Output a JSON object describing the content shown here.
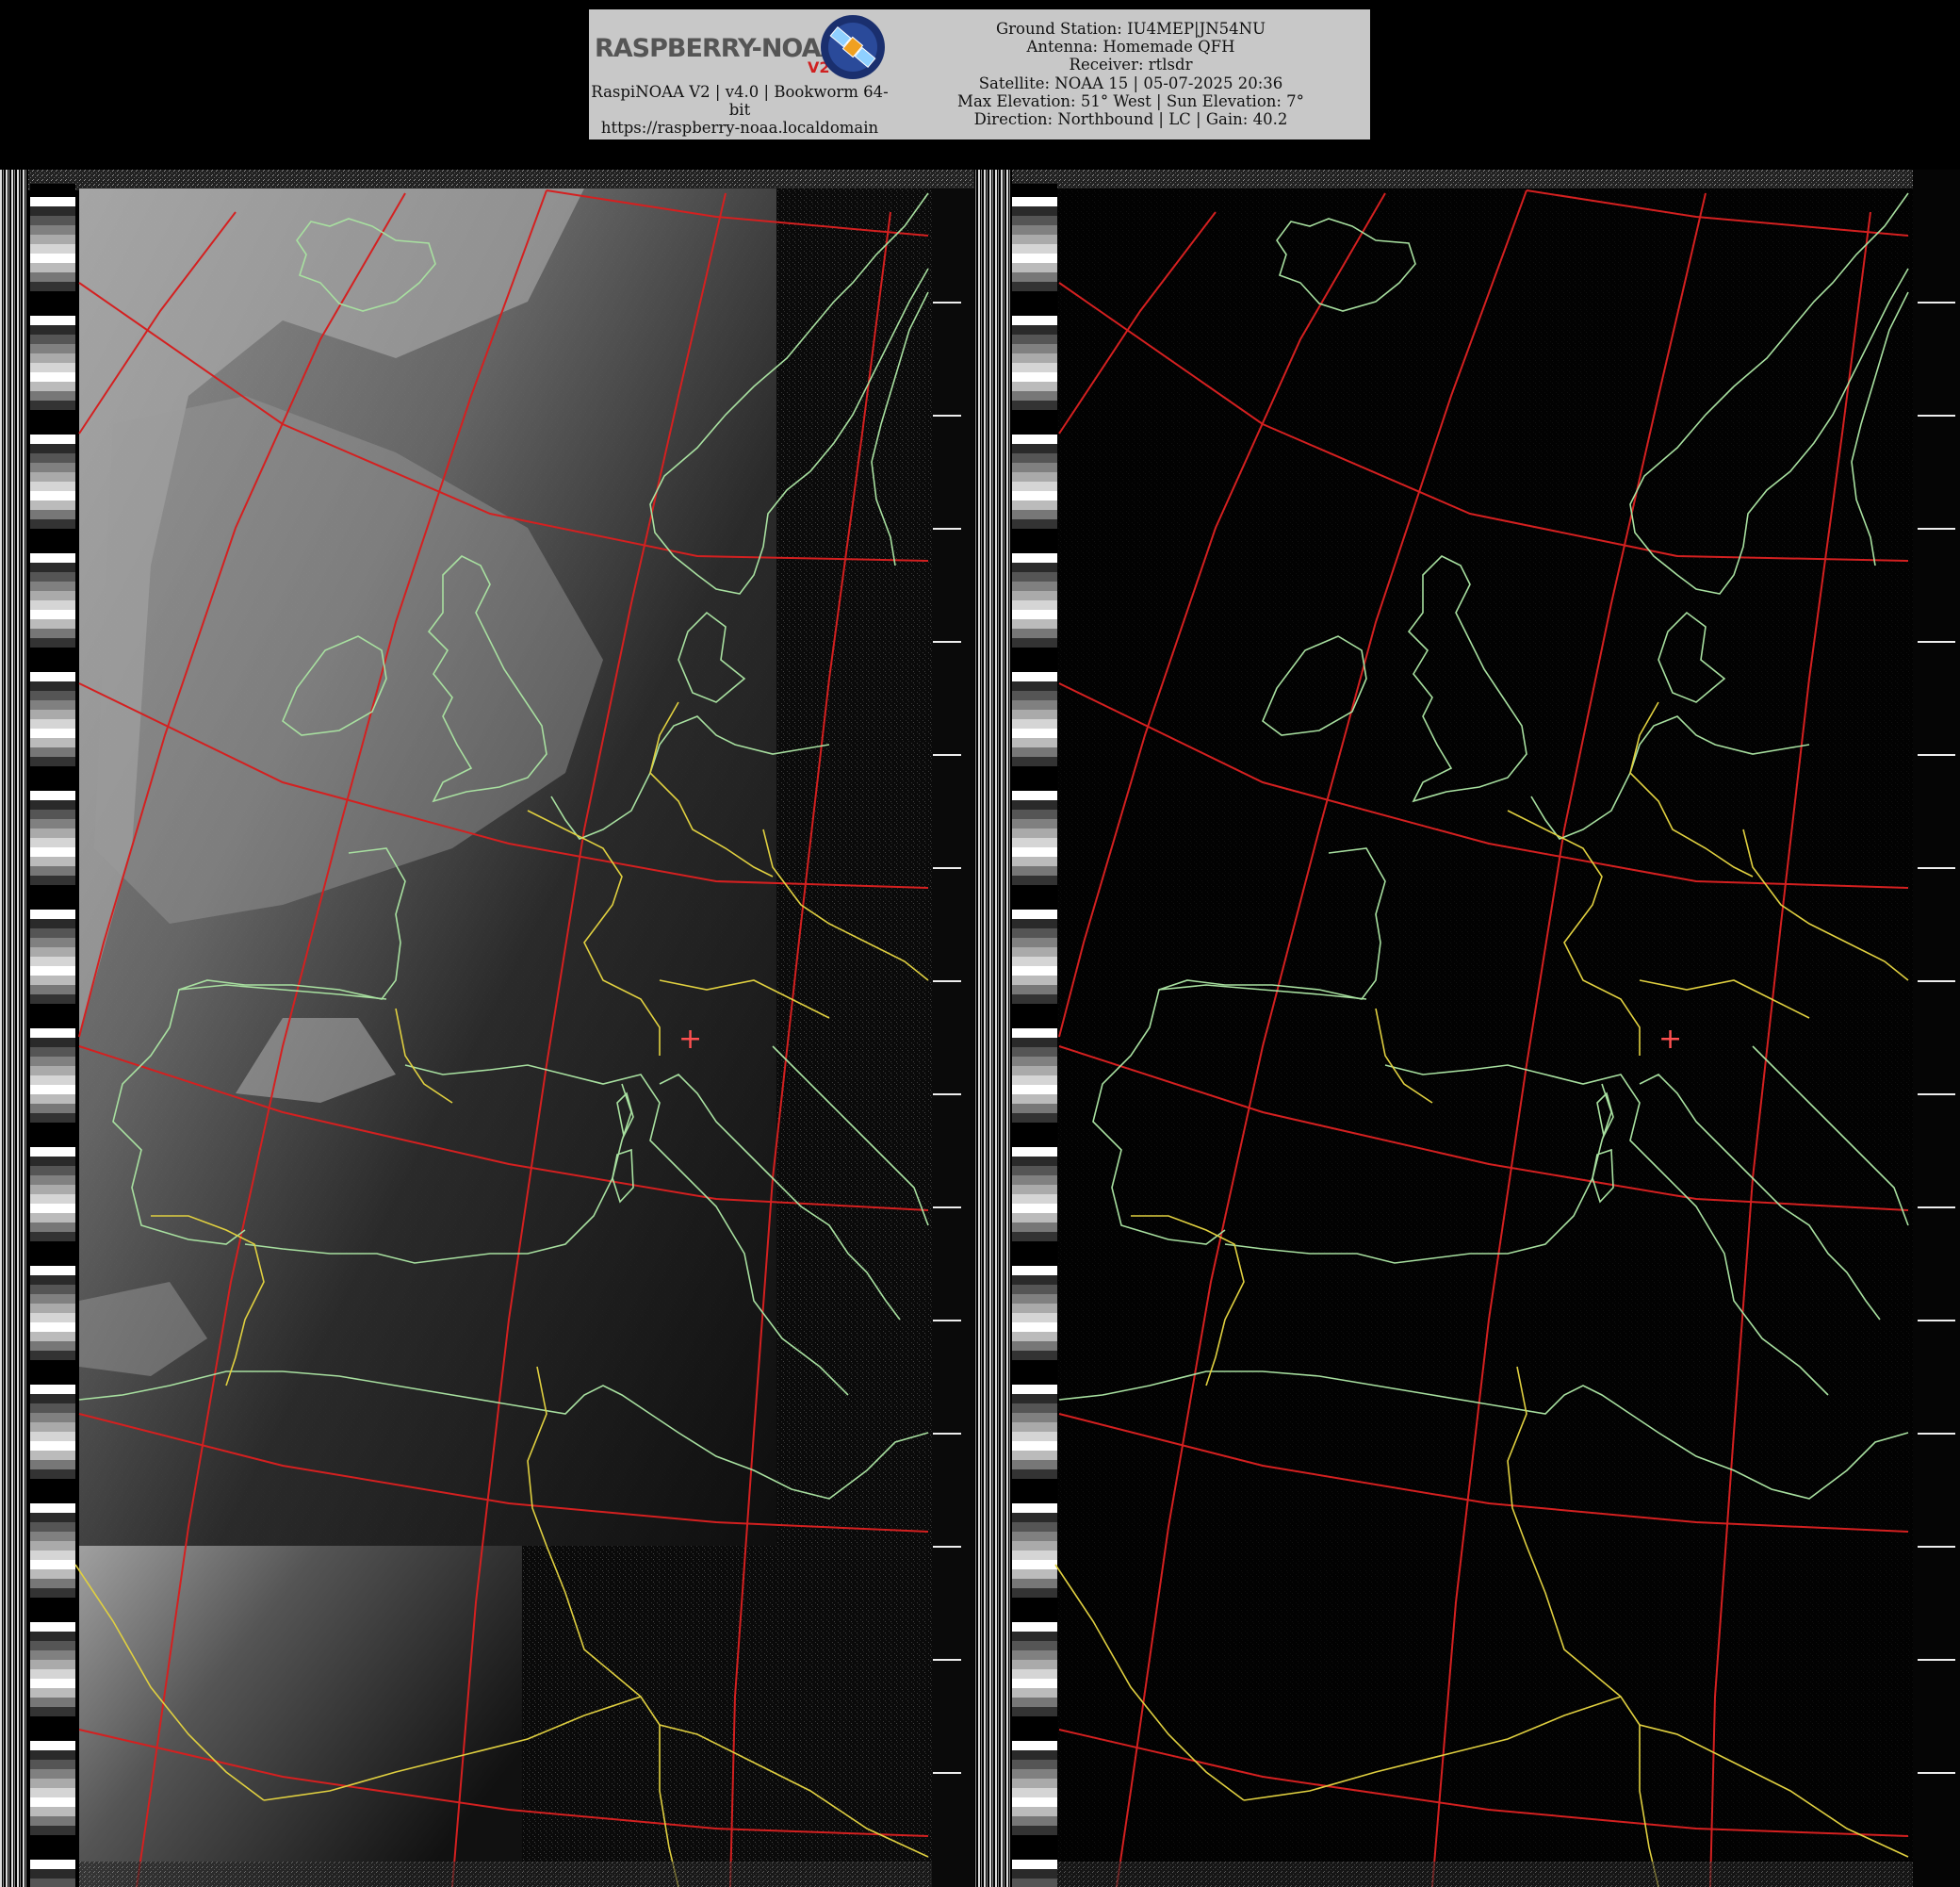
{
  "header": {
    "logo_text": "RASPBERRY-NOAA",
    "logo_version": "V2",
    "version_line": "RaspiNOAA V2 | v4.0 | Bookworm 64-bit",
    "url": "https://raspberry-noaa.localdomain",
    "pass_info": [
      "Ground Station: IU4MEP|JN54NU",
      "Antenna: Homemade QFH",
      "Receiver: rtlsdr",
      "Satellite: NOAA 15 | 05-07-2025 20:36",
      "Max Elevation: 51° West | Sun Elevation: 7°",
      "Direction: Northbound | LC | Gain: 40.2"
    ]
  },
  "image": {
    "channels": [
      "visible",
      "infrared"
    ],
    "colors": {
      "graticule": "#d42020",
      "coastline": "#a8e0a0",
      "border": "#e0d040",
      "marker": "#ff5050"
    },
    "marker_symbol": "+"
  }
}
